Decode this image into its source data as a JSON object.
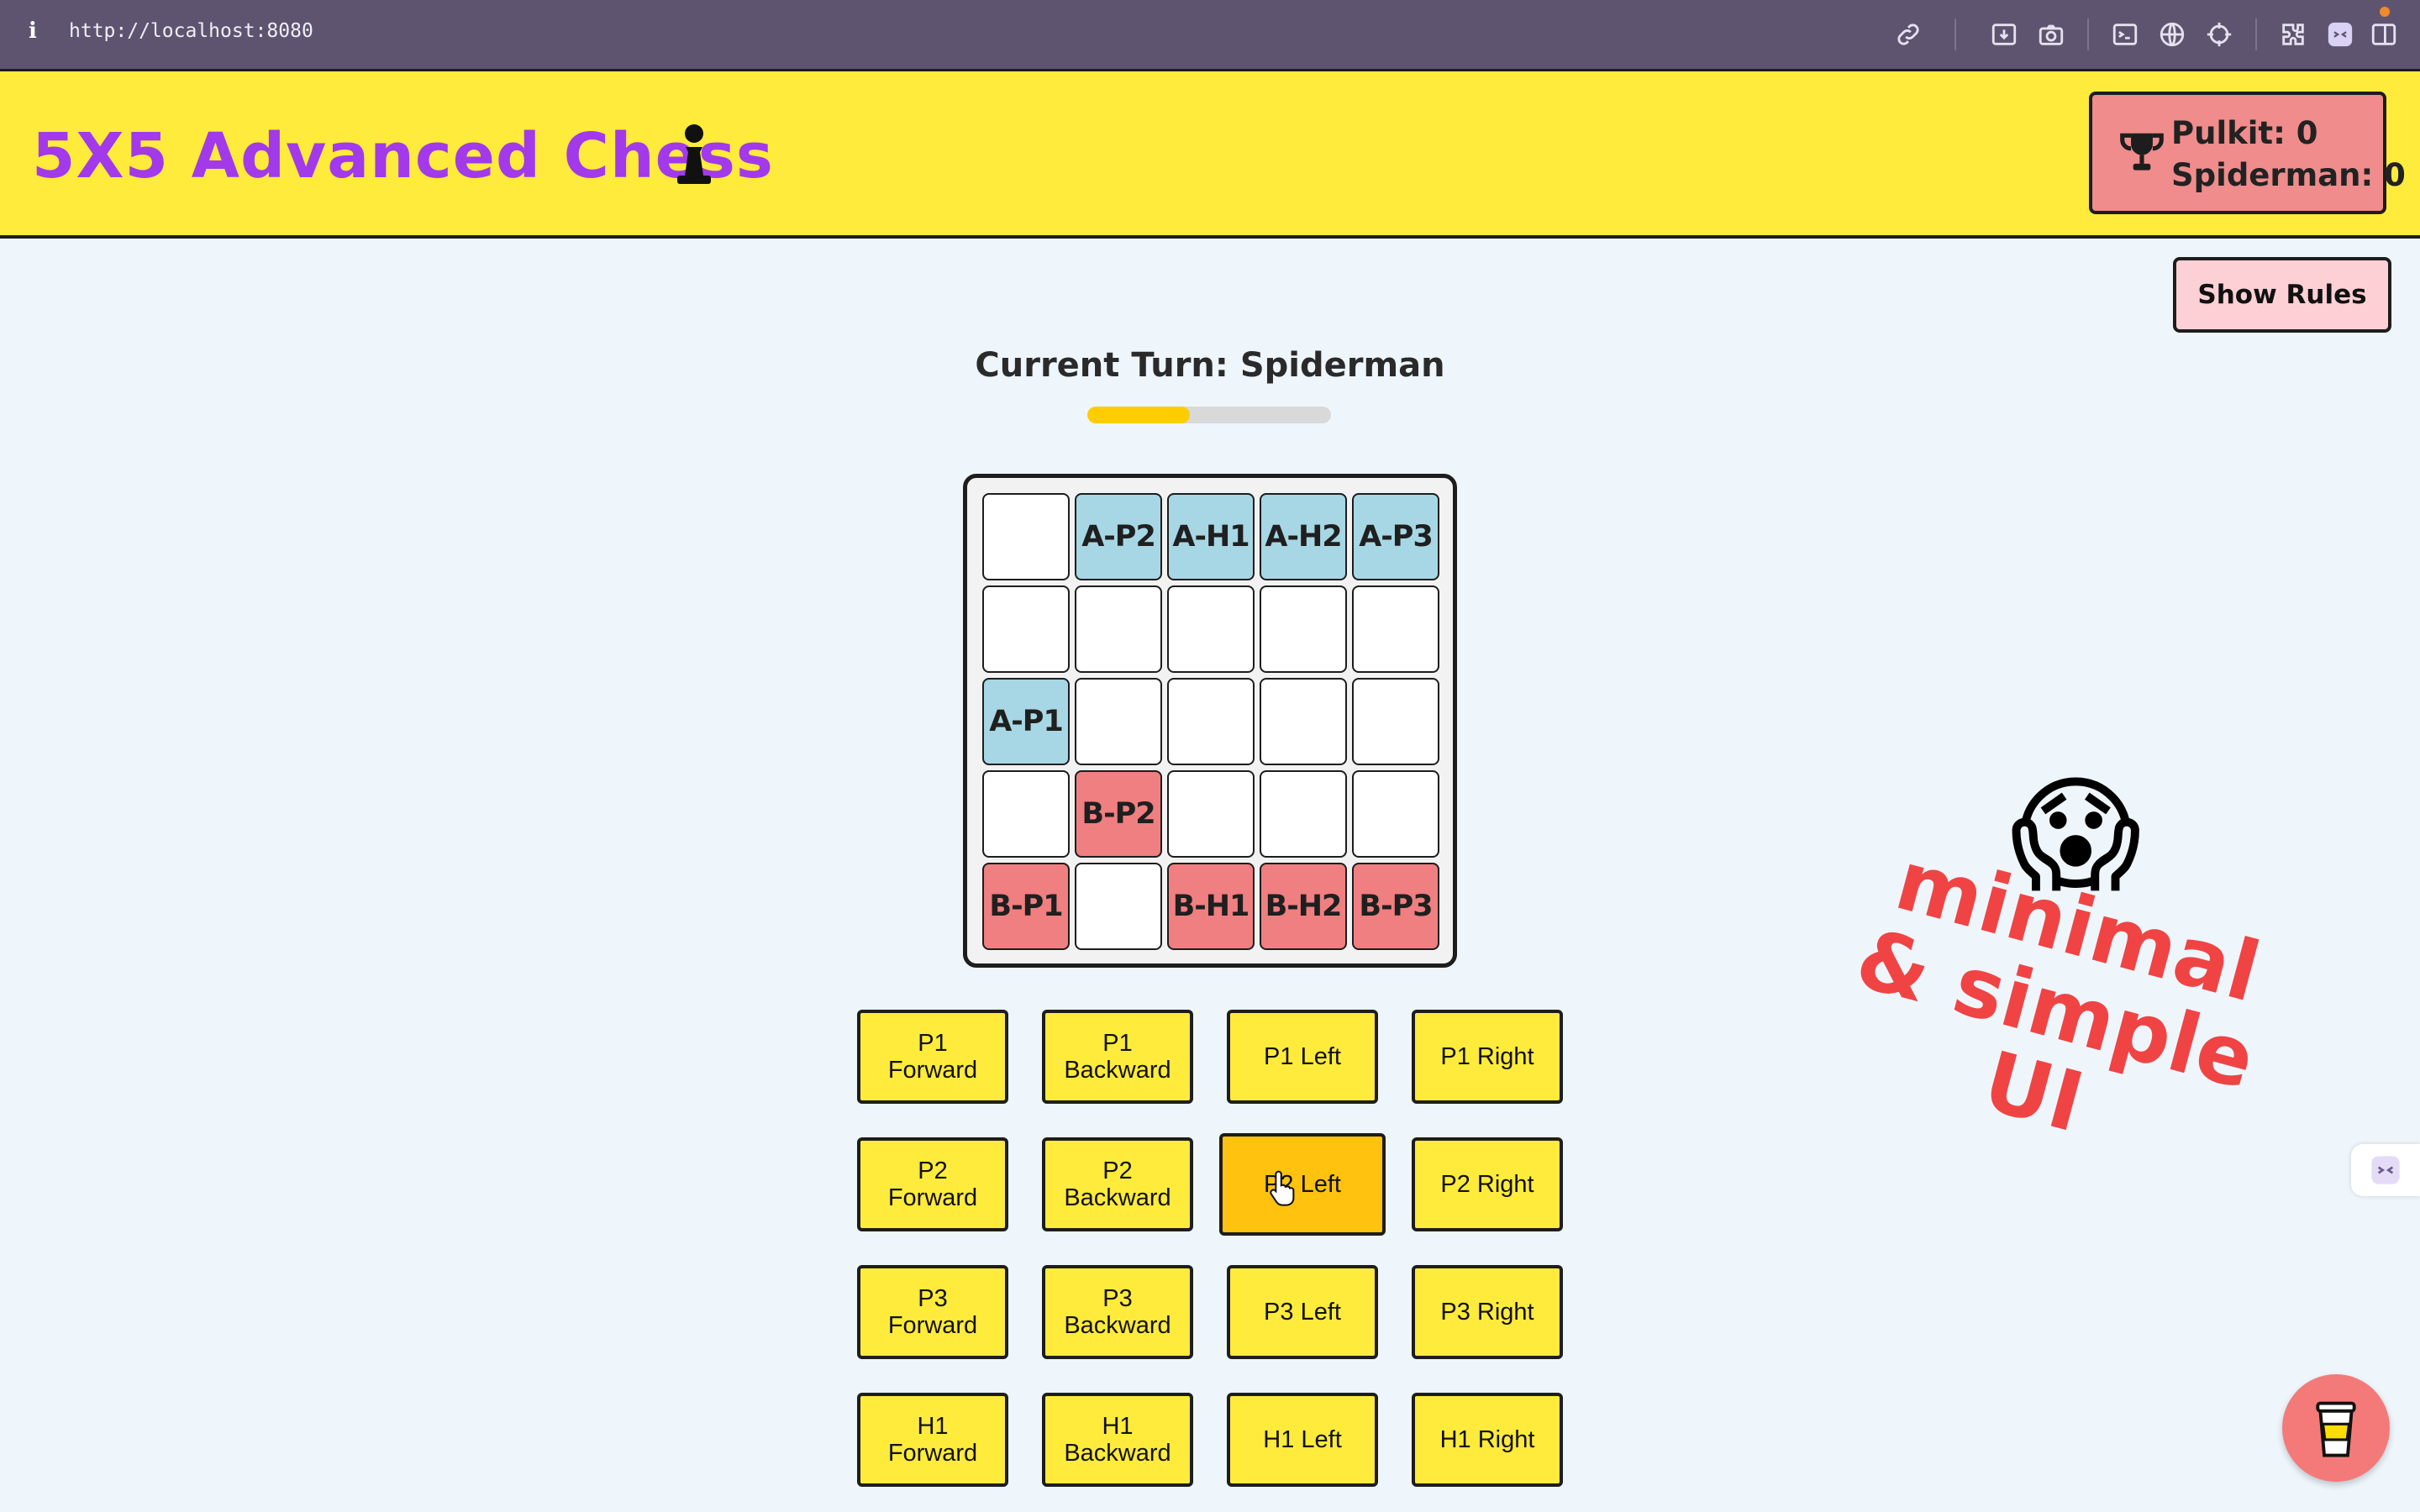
{
  "browser": {
    "info_label": "i",
    "url": "http://localhost:8080"
  },
  "header": {
    "title": "5X5 Advanced Chess",
    "title_color": "#a239ea",
    "background": "#ffeb3b",
    "scores": [
      {
        "label": "Pulkit: 0"
      },
      {
        "label": "Spiderman: 0"
      }
    ]
  },
  "rules_button": {
    "label": "Show Rules"
  },
  "turn": {
    "text": "Current Turn: Spiderman",
    "timer_fraction": 0.42
  },
  "board": {
    "rows": [
      [
        "",
        "A-P2",
        "A-H1",
        "A-H2",
        "A-P3"
      ],
      [
        "",
        "",
        "",
        "",
        ""
      ],
      [
        "A-P1",
        "",
        "",
        "",
        ""
      ],
      [
        "",
        "B-P2",
        "",
        "",
        ""
      ],
      [
        "B-P1",
        "",
        "B-H1",
        "B-H2",
        "B-P3"
      ]
    ],
    "player_a_color": "#a7d7e5",
    "player_b_color": "#ef7f80"
  },
  "moves": {
    "rows": [
      [
        "P1\nForward",
        "P1\nBackward",
        "P1 Left",
        "P1 Right"
      ],
      [
        "P2\nForward",
        "P2\nBackward",
        "P2 Left",
        "P2 Right"
      ],
      [
        "P3\nForward",
        "P3\nBackward",
        "P3 Left",
        "P3 Right"
      ],
      [
        "H1\nForward",
        "H1\nBackward",
        "H1 Left",
        "H1 Right"
      ]
    ],
    "hovered": "P2 Left"
  },
  "promo": {
    "emoji": "😱",
    "text": "minimal\n& simple UI",
    "color": "#f04444"
  }
}
